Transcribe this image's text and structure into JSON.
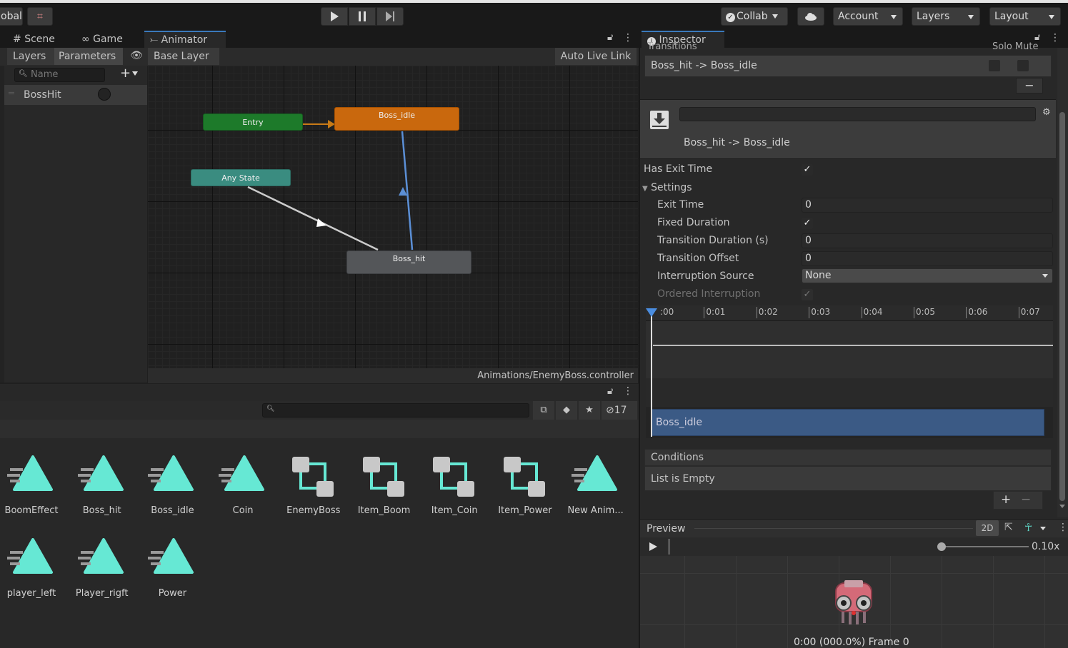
{
  "toolbar": {
    "global_label": "obal",
    "play_icon": "play-icon",
    "pause_icon": "pause-icon",
    "step_icon": "step-icon",
    "collab": "Collab",
    "account": "Account",
    "layers": "Layers",
    "layout": "Layout"
  },
  "tabs": {
    "scene": "Scene",
    "game": "Game",
    "animator": "Animator",
    "inspector": "Inspector"
  },
  "animator": {
    "layers_tab": "Layers",
    "parameters_tab": "Parameters",
    "breadcrumb": "Base Layer",
    "auto_live_link": "Auto Live Link",
    "search_placeholder": "Name",
    "parameter_name": "BossHit",
    "states": {
      "entry": "Entry",
      "boss_idle": "Boss_idle",
      "any_state": "Any State",
      "boss_hit": "Boss_hit"
    },
    "controller_path": "Animations/EnemyBoss.controller"
  },
  "project": {
    "hidden_count": "17",
    "assets": [
      {
        "name": "BoomEffect",
        "kind": "clip"
      },
      {
        "name": "Boss_hit",
        "kind": "clip"
      },
      {
        "name": "Boss_idle",
        "kind": "clip"
      },
      {
        "name": "Coin",
        "kind": "clip"
      },
      {
        "name": "EnemyBoss",
        "kind": "controller"
      },
      {
        "name": "Item_Boom",
        "kind": "controller"
      },
      {
        "name": "Item_Coin",
        "kind": "controller"
      },
      {
        "name": "Item_Power",
        "kind": "controller"
      },
      {
        "name": "New Anim...",
        "kind": "clip"
      },
      {
        "name": "player_left",
        "kind": "clip"
      },
      {
        "name": "Player_rigft",
        "kind": "clip"
      },
      {
        "name": "Power",
        "kind": "clip"
      }
    ]
  },
  "inspector": {
    "header_cut": "Transitions",
    "solo_mute_cut": "Solo Mute",
    "transition_item": "Boss_hit -> Boss_idle",
    "transition_title": "Boss_hit -> Boss_idle",
    "has_exit_time": "Has Exit Time",
    "settings": "Settings",
    "exit_time_label": "Exit Time",
    "exit_time": "0",
    "fixed_duration_label": "Fixed Duration",
    "transition_duration_label": "Transition Duration (s)",
    "transition_duration": "0",
    "transition_offset_label": "Transition Offset",
    "transition_offset": "0",
    "interruption_source_label": "Interruption Source",
    "interruption_source": "None",
    "ordered_interruption_label": "Ordered Interruption",
    "timeline_ticks": [
      ":00",
      "0:01",
      "0:02",
      "0:03",
      "0:04",
      "0:05",
      "0:06",
      "0:07"
    ],
    "timeline_clip": "Boss_idle",
    "conditions": "Conditions",
    "list_empty": "List is Empty",
    "plus": "+",
    "minus": "−",
    "preview": "Preview",
    "mode_2d": "2D",
    "speed": "0.10x",
    "preview_readout": "0:00 (000.0%) Frame 0"
  }
}
